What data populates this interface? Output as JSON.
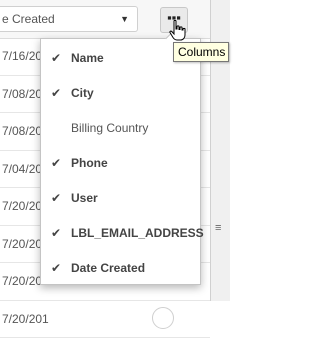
{
  "toolbar": {
    "sort_value": "e Created",
    "sort_caret": "▼",
    "columns_button_glyph": "▪▪▪",
    "tooltip": "Columns"
  },
  "list": {
    "rows": [
      "7/16/201",
      "7/08/201",
      "7/08/201",
      "7/04/201",
      "7/20/201",
      "7/20/201",
      "7/20/201",
      "7/20/201"
    ]
  },
  "right_pane": {
    "gear_glyph": "≡"
  },
  "column_menu": {
    "items": [
      {
        "label": "Name",
        "checked": true,
        "check": "✔"
      },
      {
        "label": "City",
        "checked": true,
        "check": "✔"
      },
      {
        "label": "Billing Country",
        "checked": false,
        "check": ""
      },
      {
        "label": "Phone",
        "checked": true,
        "check": "✔"
      },
      {
        "label": "User",
        "checked": true,
        "check": "✔"
      },
      {
        "label": "LBL_EMAIL_ADDRESS",
        "checked": true,
        "check": "✔"
      },
      {
        "label": "Date Created",
        "checked": true,
        "check": "✔"
      }
    ]
  }
}
